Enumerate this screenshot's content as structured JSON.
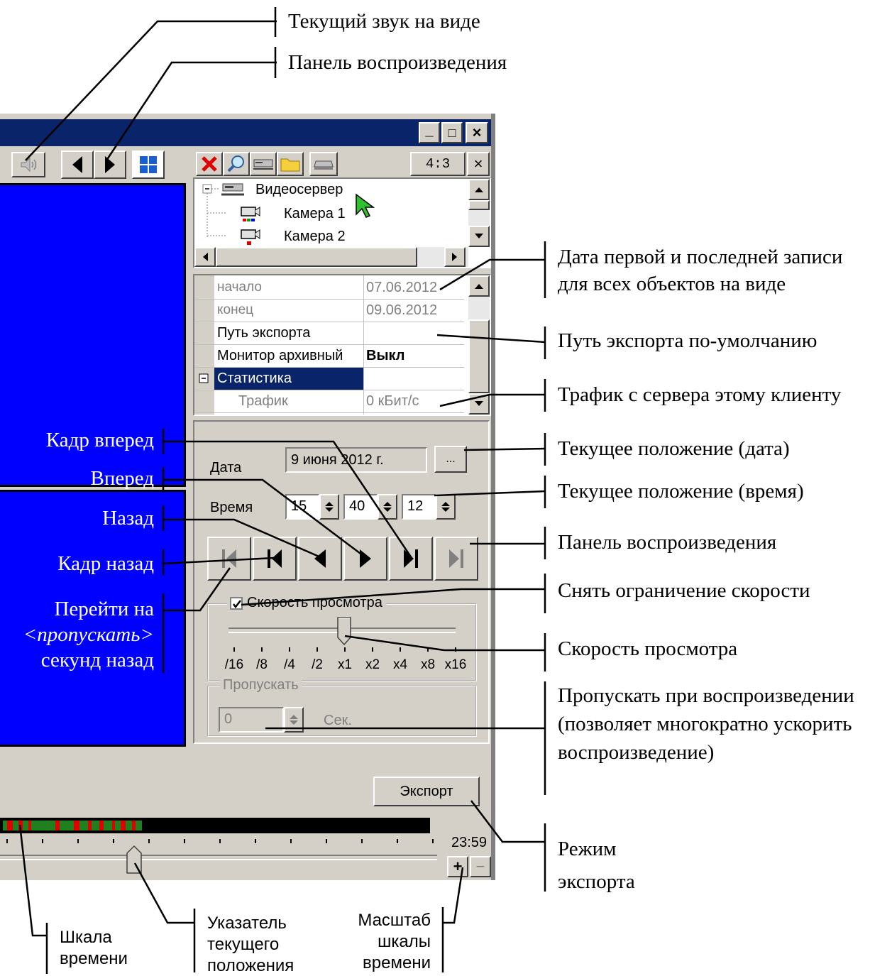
{
  "window": {
    "title_buttons": [
      "_",
      "□",
      "×"
    ],
    "toolbar_ratio": "4:3",
    "close_glyph": "×"
  },
  "tree": {
    "server": "Видеосервер",
    "cameras": [
      "Камера 1",
      "Камера 2"
    ]
  },
  "props": [
    {
      "key": "начало",
      "value": "07.06.2012",
      "muted": true
    },
    {
      "key": "конец",
      "value": "09.06.2012",
      "muted": true
    },
    {
      "key": "Путь экспорта",
      "value": ""
    },
    {
      "key": "Монитор архивный",
      "value": "Выкл"
    },
    {
      "key": "Статистика",
      "value": "",
      "selected": true
    },
    {
      "key": "Трафик",
      "value": "0 кБит/с",
      "muted": true
    }
  ],
  "playback": {
    "date_label": "Дата",
    "date_value": "9 июня 2012 г.",
    "date_btn": "...",
    "time_label": "Время",
    "hours": "15",
    "minutes": "40",
    "seconds": "12",
    "speed_group": "Скорость просмотра",
    "speed_checked": true,
    "speed_ticks": [
      "/16",
      "/8",
      "/4",
      "/2",
      "x1",
      "x2",
      "x4",
      "x8",
      "x16"
    ],
    "speed_position": 0.5,
    "skip_group": "Пропускать",
    "skip_value": "0",
    "skip_unit": "Сек.",
    "export_button": "Экспорт"
  },
  "timeline": {
    "end_time": "23:59",
    "zoom_in": "+",
    "zoom_out": "−",
    "pointer_position": 0.3
  },
  "annotations": {
    "sound": "Текущий звук на виде",
    "playback_panel_top": "Панель воспроизведения",
    "dates": [
      "Дата первой и последней записи",
      "для всех объектов на виде"
    ],
    "export_path": "Путь экспорта по-умолчанию",
    "traffic": "Трафик с сервера этому клиенту",
    "cur_date": "Текущее положение (дата)",
    "cur_time": "Текущее положение (время)",
    "playback_panel": "Панель воспроизведения",
    "speed_limit": "Снять ограничение скорости",
    "speed": "Скорость просмотра",
    "skip": [
      "Пропускать при воспроизведении",
      "(позволяет многократно ускорить",
      "воспроизведение)"
    ],
    "export_mode": [
      "Режим",
      "экспорта"
    ],
    "frame_forward": "Кадр вперед",
    "forward": "Вперед",
    "back": "Назад",
    "frame_back": "Кадр назад",
    "jump_back": [
      "Перейти на",
      "<пропускать>",
      "секунд назад"
    ],
    "timescale": [
      "Шкала",
      "времени"
    ],
    "pointer": [
      "Указатель",
      "текущего",
      "положения"
    ],
    "scale": [
      "Масштаб",
      "шкалы",
      "времени"
    ]
  }
}
